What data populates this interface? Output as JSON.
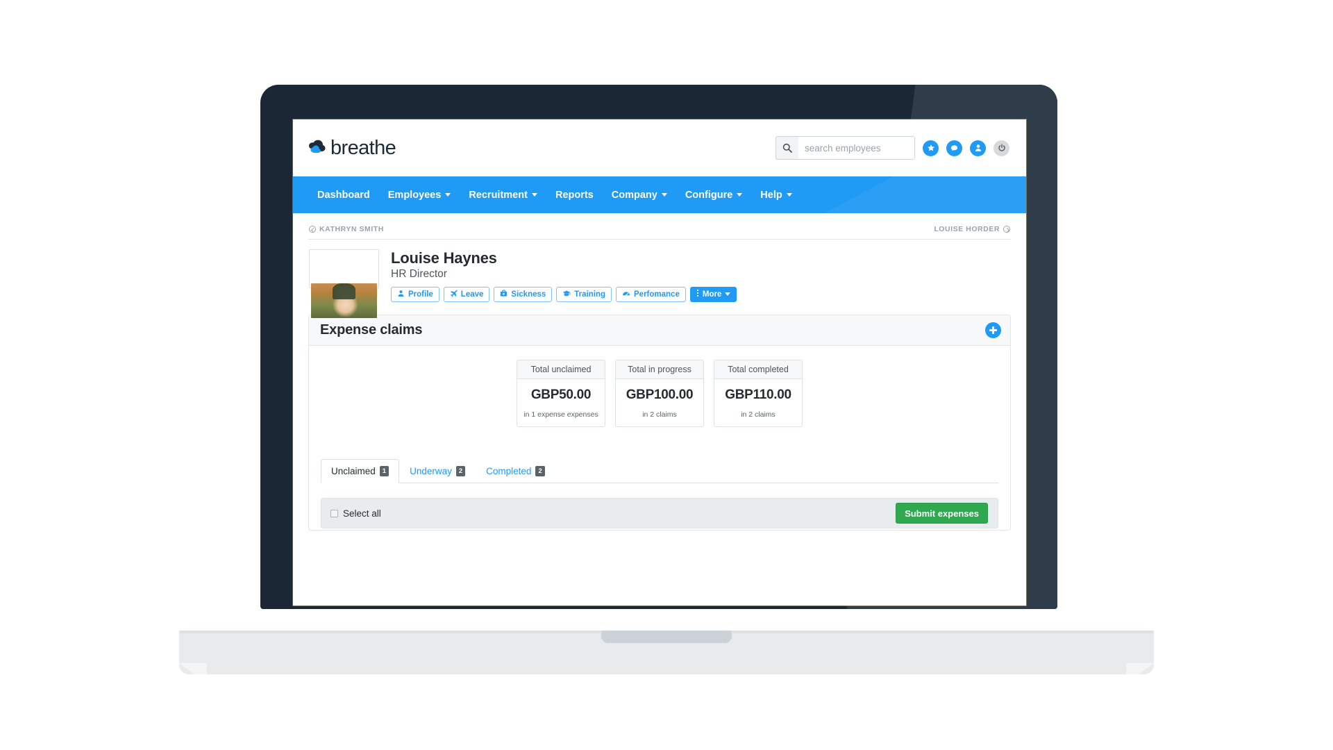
{
  "brand": {
    "name": "breathe",
    "logo_icon": "cloud-icon",
    "accent": "#1f9af5",
    "dark": "#1d2b38"
  },
  "topbar": {
    "search": {
      "placeholder": "search employees",
      "value": "",
      "icon": "search-icon"
    },
    "icons": [
      {
        "name": "star-icon",
        "glyph": "★",
        "color": "#1f9af5"
      },
      {
        "name": "chat-icon",
        "glyph": "●",
        "color": "#1f9af5"
      },
      {
        "name": "user-icon",
        "glyph": "●",
        "color": "#1f9af5"
      },
      {
        "name": "power-icon",
        "glyph": "⏻",
        "color": "#d7dadd"
      }
    ]
  },
  "nav": {
    "items": [
      {
        "label": "Dashboard",
        "has_dropdown": false
      },
      {
        "label": "Employees",
        "has_dropdown": true
      },
      {
        "label": "Recruitment",
        "has_dropdown": true
      },
      {
        "label": "Reports",
        "has_dropdown": false
      },
      {
        "label": "Company",
        "has_dropdown": true
      },
      {
        "label": "Configure",
        "has_dropdown": true
      },
      {
        "label": "Help",
        "has_dropdown": true
      }
    ]
  },
  "breadcrumb": {
    "prev": {
      "label": "KATHRYN SMITH",
      "icon": "arrow-left-circle-icon"
    },
    "next": {
      "label": "LOUISE HORDER",
      "icon": "arrow-right-circle-icon"
    }
  },
  "employee": {
    "name": "Louise Haynes",
    "role": "HR Director",
    "photo_alt": "employee-photo",
    "actions": [
      {
        "label": "Profile",
        "icon": "person-icon",
        "primary": false
      },
      {
        "label": "Leave",
        "icon": "plane-icon",
        "primary": false
      },
      {
        "label": "Sickness",
        "icon": "medical-kit-icon",
        "primary": false
      },
      {
        "label": "Training",
        "icon": "graduation-cap-icon",
        "primary": false
      },
      {
        "label": "Perfomance",
        "icon": "gauge-icon",
        "primary": false
      },
      {
        "label": "More",
        "icon": "dots-vertical-icon",
        "primary": true,
        "has_dropdown": true
      }
    ]
  },
  "panel": {
    "title": "Expense claims",
    "add_icon": "plus-circle-icon"
  },
  "stats": [
    {
      "head": "Total unclaimed",
      "value": "GBP50.00",
      "sub": "in 1 expense expenses"
    },
    {
      "head": "Total in progress",
      "value": "GBP100.00",
      "sub": "in 2 claims"
    },
    {
      "head": "Total completed",
      "value": "GBP110.00",
      "sub": "in 2 claims"
    }
  ],
  "tabs": [
    {
      "label": "Unclaimed",
      "count": "1",
      "active": true
    },
    {
      "label": "Underway",
      "count": "2",
      "active": false
    },
    {
      "label": "Completed",
      "count": "2",
      "active": false
    }
  ],
  "toolbar": {
    "select_all_label": "Select all",
    "select_all_checked": false,
    "submit_label": "Submit expenses",
    "submit_color": "#2fa84f"
  }
}
